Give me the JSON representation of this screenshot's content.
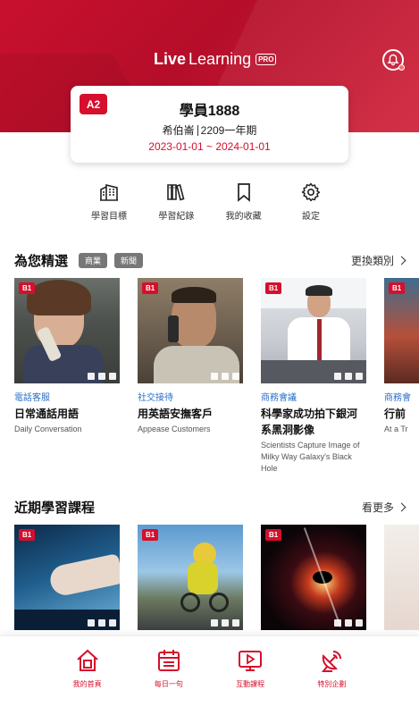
{
  "header": {
    "logo_bold": "Live",
    "logo_light": "Learning",
    "logo_badge": "PRO",
    "notification_icon": "bell-icon"
  },
  "student": {
    "level": "A2",
    "name": "學員1888",
    "school": "希伯崙",
    "term": "2209一年期",
    "period": "2023-01-01 ~ 2024-01-01"
  },
  "quick_menu": [
    {
      "label": "學習目標",
      "icon": "building-icon"
    },
    {
      "label": "學習紀錄",
      "icon": "books-icon"
    },
    {
      "label": "我的收藏",
      "icon": "bookmark-icon"
    },
    {
      "label": "設定",
      "icon": "gear-icon"
    }
  ],
  "featured": {
    "title": "為您精選",
    "tags": [
      "商業",
      "新聞"
    ],
    "link": "更換類別",
    "items": [
      {
        "badge": "B1",
        "category": "電話客服",
        "title": "日常通話用語",
        "subtitle": "Daily Conversation"
      },
      {
        "badge": "B1",
        "category": "社交接待",
        "title": "用英語安撫客戶",
        "subtitle": "Appease Customers"
      },
      {
        "badge": "B1",
        "category": "商務會議",
        "title": "科學家成功拍下銀河系黑洞影像",
        "subtitle": "Scientists Capture Image of Milky Way Galaxy's Black Hole"
      },
      {
        "badge": "B1",
        "category": "商務會",
        "title": "行前",
        "subtitle": "At a Tr"
      }
    ]
  },
  "recent": {
    "title": "近期學習課程",
    "link": "看更多",
    "items": [
      {
        "badge": "B1"
      },
      {
        "badge": "B1"
      },
      {
        "badge": "B1"
      },
      {
        "badge": ""
      }
    ]
  },
  "bottom_nav": [
    {
      "label": "我的首頁",
      "icon": "home-icon"
    },
    {
      "label": "每日一句",
      "icon": "calendar-icon"
    },
    {
      "label": "互動課程",
      "icon": "tv-icon"
    },
    {
      "label": "特別企劃",
      "icon": "satellite-icon"
    }
  ],
  "colors": {
    "brand": "#d50f2c",
    "category": "#2a6fc9"
  }
}
